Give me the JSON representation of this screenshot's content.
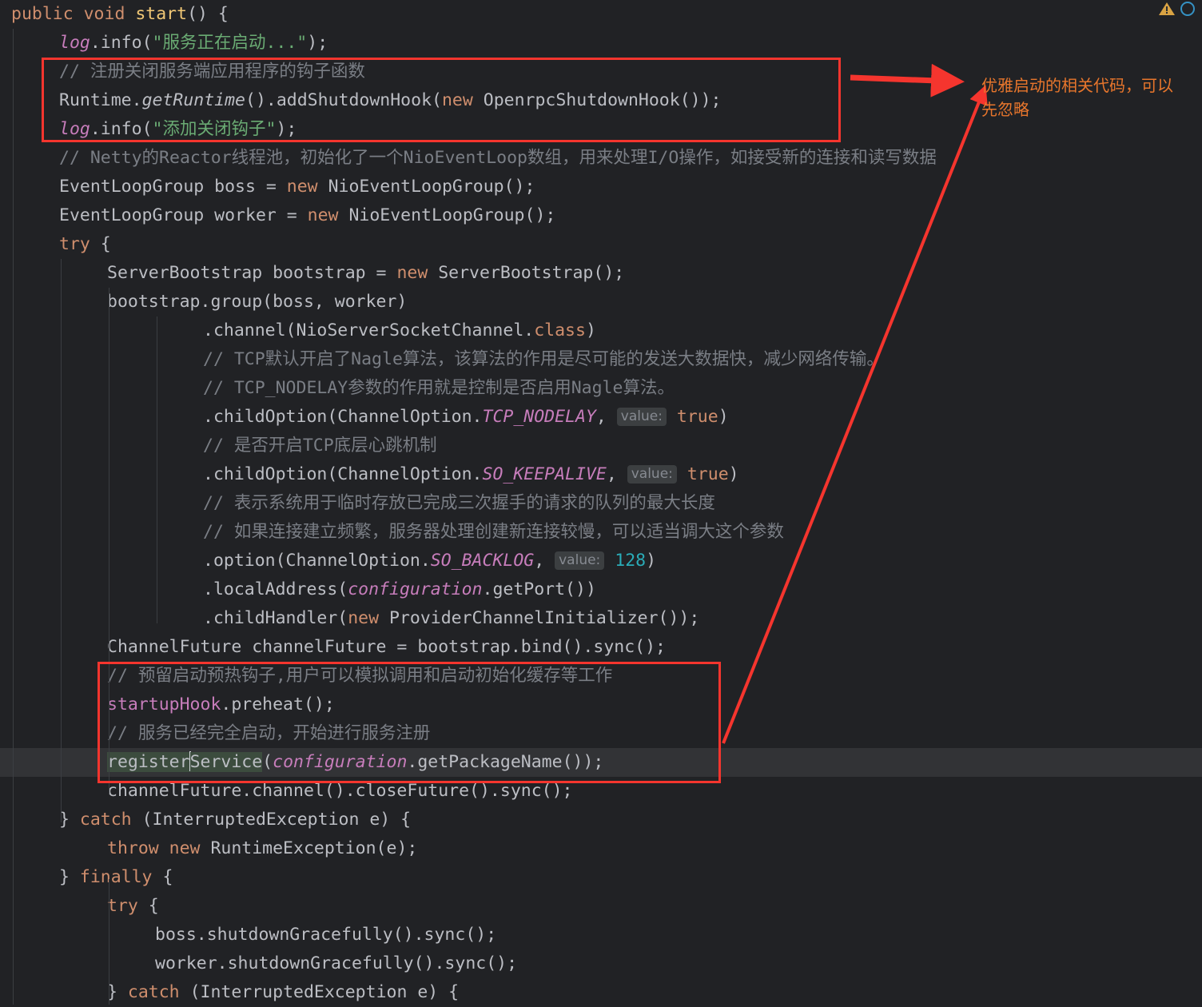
{
  "editor": {
    "theme_background": "#212225",
    "current_line_background": "#323336",
    "selection_background": "#3c4c3e",
    "annotation_color": "#f5352e",
    "annotation_text_color": "#e8762c",
    "font_size_px": 21.5,
    "line_height_px": 36
  },
  "annotations": {
    "note_1": "优雅启动的相关代码，可以先忽略",
    "box_1_label": "graceful-startup-hook-box",
    "box_2_label": "service-registration-box",
    "arrow_1_label": "arrow-to-startup-hook-box",
    "arrow_2_label": "arrow-to-service-registration-box"
  },
  "status_icons": {
    "warning_icon": "warning-triangle",
    "inspection_icon": "inspection-circle"
  },
  "code": {
    "lines": [
      {
        "n": 1,
        "indent": 0,
        "tokens": [
          {
            "t": "public ",
            "c": "kw"
          },
          {
            "t": "void ",
            "c": "kw"
          },
          {
            "t": "start",
            "c": "mdecl"
          },
          {
            "t": "() {",
            "c": "punc"
          }
        ]
      },
      {
        "n": 2,
        "indent": 1,
        "tokens": [
          {
            "t": "log",
            "c": "fld-i"
          },
          {
            "t": ".info(",
            "c": "plain"
          },
          {
            "t": "\"服务正在启动...\"",
            "c": "str"
          },
          {
            "t": ");",
            "c": "plain"
          }
        ]
      },
      {
        "n": 3,
        "indent": 1,
        "tokens": [
          {
            "t": "// 注册关闭服务端应用程序的钩子函数",
            "c": "cmt"
          }
        ]
      },
      {
        "n": 4,
        "indent": 1,
        "tokens": [
          {
            "t": "Runtime.",
            "c": "plain"
          },
          {
            "t": "getRuntime",
            "c": "stat"
          },
          {
            "t": "().addShutdownHook(",
            "c": "plain"
          },
          {
            "t": "new ",
            "c": "kw"
          },
          {
            "t": "OpenrpcShutdownHook());",
            "c": "plain"
          }
        ]
      },
      {
        "n": 5,
        "indent": 1,
        "tokens": [
          {
            "t": "log",
            "c": "fld-i"
          },
          {
            "t": ".info(",
            "c": "plain"
          },
          {
            "t": "\"添加关闭钩子\"",
            "c": "str"
          },
          {
            "t": ");",
            "c": "plain"
          }
        ]
      },
      {
        "n": 6,
        "indent": 1,
        "tokens": [
          {
            "t": "// Netty的Reactor线程池，初始化了一个NioEventLoop数组，用来处理I/O操作，如接受新的连接和读写数据",
            "c": "cmt"
          }
        ]
      },
      {
        "n": 7,
        "indent": 1,
        "tokens": [
          {
            "t": "EventLoopGroup boss = ",
            "c": "plain"
          },
          {
            "t": "new ",
            "c": "kw"
          },
          {
            "t": "NioEventLoopGroup();",
            "c": "plain"
          }
        ]
      },
      {
        "n": 8,
        "indent": 1,
        "tokens": [
          {
            "t": "EventLoopGroup worker = ",
            "c": "plain"
          },
          {
            "t": "new ",
            "c": "kw"
          },
          {
            "t": "NioEventLoopGroup();",
            "c": "plain"
          }
        ]
      },
      {
        "n": 9,
        "indent": 1,
        "tokens": [
          {
            "t": "try",
            "c": "kw"
          },
          {
            "t": " {",
            "c": "punc"
          }
        ]
      },
      {
        "n": 10,
        "indent": 2,
        "tokens": [
          {
            "t": "ServerBootstrap bootstrap = ",
            "c": "plain"
          },
          {
            "t": "new ",
            "c": "kw"
          },
          {
            "t": "ServerBootstrap();",
            "c": "plain"
          }
        ]
      },
      {
        "n": 11,
        "indent": 2,
        "tokens": [
          {
            "t": "bootstrap.group(boss, worker)",
            "c": "plain"
          }
        ]
      },
      {
        "n": 12,
        "indent": 4,
        "tokens": [
          {
            "t": ".channel(NioServerSocketChannel.",
            "c": "plain"
          },
          {
            "t": "class",
            "c": "kw"
          },
          {
            "t": ")",
            "c": "plain"
          }
        ]
      },
      {
        "n": 13,
        "indent": 4,
        "tokens": [
          {
            "t": "// TCP默认开启了Nagle算法，该算法的作用是尽可能的发送大数据快，减少网络传输。",
            "c": "cmt"
          }
        ]
      },
      {
        "n": 14,
        "indent": 4,
        "tokens": [
          {
            "t": "// TCP_NODELAY参数的作用就是控制是否启用Nagle算法。",
            "c": "cmt"
          }
        ]
      },
      {
        "n": 15,
        "indent": 4,
        "tokens": [
          {
            "t": ".childOption(ChannelOption.",
            "c": "plain"
          },
          {
            "t": "TCP_NODELAY",
            "c": "loc-i"
          },
          {
            "t": ", ",
            "c": "plain"
          },
          {
            "t": "value:",
            "c": "hint"
          },
          {
            "t": " ",
            "c": "plain"
          },
          {
            "t": "true",
            "c": "kw"
          },
          {
            "t": ")",
            "c": "plain"
          }
        ]
      },
      {
        "n": 16,
        "indent": 4,
        "tokens": [
          {
            "t": "// 是否开启TCP底层心跳机制",
            "c": "cmt"
          }
        ]
      },
      {
        "n": 17,
        "indent": 4,
        "tokens": [
          {
            "t": ".childOption(ChannelOption.",
            "c": "plain"
          },
          {
            "t": "SO_KEEPALIVE",
            "c": "loc-i"
          },
          {
            "t": ", ",
            "c": "plain"
          },
          {
            "t": "value:",
            "c": "hint"
          },
          {
            "t": " ",
            "c": "plain"
          },
          {
            "t": "true",
            "c": "kw"
          },
          {
            "t": ")",
            "c": "plain"
          }
        ]
      },
      {
        "n": 18,
        "indent": 4,
        "tokens": [
          {
            "t": "// 表示系统用于临时存放已完成三次握手的请求的队列的最大长度",
            "c": "cmt"
          }
        ]
      },
      {
        "n": 19,
        "indent": 4,
        "tokens": [
          {
            "t": "// 如果连接建立频繁，服务器处理创建新连接较慢，可以适当调大这个参数",
            "c": "cmt"
          }
        ]
      },
      {
        "n": 20,
        "indent": 4,
        "tokens": [
          {
            "t": ".option(ChannelOption.",
            "c": "plain"
          },
          {
            "t": "SO_BACKLOG",
            "c": "loc-i"
          },
          {
            "t": ", ",
            "c": "plain"
          },
          {
            "t": "value:",
            "c": "hint"
          },
          {
            "t": " ",
            "c": "plain"
          },
          {
            "t": "128",
            "c": "num"
          },
          {
            "t": ")",
            "c": "plain"
          }
        ]
      },
      {
        "n": 21,
        "indent": 4,
        "tokens": [
          {
            "t": ".localAddress(",
            "c": "plain"
          },
          {
            "t": "configuration",
            "c": "fld-i"
          },
          {
            "t": ".getPort())",
            "c": "plain"
          }
        ]
      },
      {
        "n": 22,
        "indent": 4,
        "tokens": [
          {
            "t": ".childHandler(",
            "c": "plain"
          },
          {
            "t": "new ",
            "c": "kw"
          },
          {
            "t": "ProviderChannelInitializer());",
            "c": "plain"
          }
        ]
      },
      {
        "n": 23,
        "indent": 2,
        "tokens": [
          {
            "t": "ChannelFuture channelFuture = bootstrap.bind().sync();",
            "c": "plain"
          }
        ]
      },
      {
        "n": 24,
        "indent": 2,
        "tokens": [
          {
            "t": "// 预留启动预热钩子,用户可以模拟调用和启动初始化缓存等工作",
            "c": "cmt"
          }
        ]
      },
      {
        "n": 25,
        "indent": 2,
        "tokens": [
          {
            "t": "startupHook",
            "c": "fld"
          },
          {
            "t": ".preheat();",
            "c": "plain"
          }
        ]
      },
      {
        "n": 26,
        "indent": 2,
        "tokens": [
          {
            "t": "// 服务已经完全启动，开始进行服务注册",
            "c": "cmt"
          }
        ]
      },
      {
        "n": 27,
        "indent": 2,
        "current": true,
        "tokens": [
          {
            "t": "registerService",
            "c": "plain sel",
            "caret_after": 8
          },
          {
            "t": "(",
            "c": "plain"
          },
          {
            "t": "configuration",
            "c": "fld-i"
          },
          {
            "t": ".getPackageName());",
            "c": "plain"
          }
        ]
      },
      {
        "n": 28,
        "indent": 2,
        "tokens": [
          {
            "t": "channelFuture.channel().closeFuture().sync();",
            "c": "plain"
          }
        ]
      },
      {
        "n": 29,
        "indent": 1,
        "tokens": [
          {
            "t": "} ",
            "c": "punc"
          },
          {
            "t": "catch",
            "c": "kw"
          },
          {
            "t": " (InterruptedException e) {",
            "c": "plain"
          }
        ]
      },
      {
        "n": 30,
        "indent": 2,
        "tokens": [
          {
            "t": "throw ",
            "c": "kw"
          },
          {
            "t": "new ",
            "c": "kw"
          },
          {
            "t": "RuntimeException(e);",
            "c": "plain"
          }
        ]
      },
      {
        "n": 31,
        "indent": 1,
        "tokens": [
          {
            "t": "} ",
            "c": "punc"
          },
          {
            "t": "finally",
            "c": "kw"
          },
          {
            "t": " {",
            "c": "plain"
          }
        ]
      },
      {
        "n": 32,
        "indent": 2,
        "tokens": [
          {
            "t": "try",
            "c": "kw"
          },
          {
            "t": " {",
            "c": "punc"
          }
        ]
      },
      {
        "n": 33,
        "indent": 3,
        "tokens": [
          {
            "t": "boss.shutdownGracefully().sync();",
            "c": "plain"
          }
        ]
      },
      {
        "n": 34,
        "indent": 3,
        "tokens": [
          {
            "t": "worker.shutdownGracefully().sync();",
            "c": "plain"
          }
        ]
      },
      {
        "n": 35,
        "indent": 2,
        "tokens": [
          {
            "t": "} ",
            "c": "punc"
          },
          {
            "t": "catch",
            "c": "kw"
          },
          {
            "t": " (InterruptedException e) {",
            "c": "plain"
          }
        ]
      }
    ]
  }
}
